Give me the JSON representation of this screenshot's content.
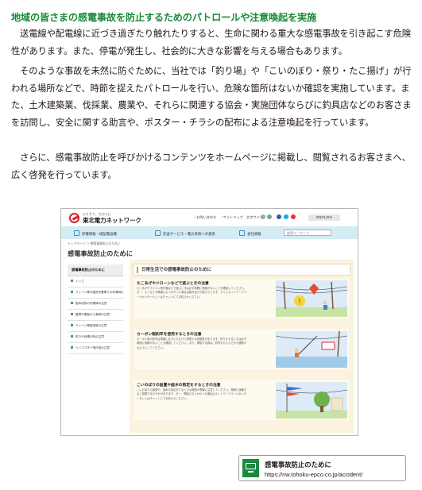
{
  "heading": "地域の皆さまの感電事故を防止するためのパトロールや注意喚起を実施",
  "paragraphs": [
    "送電線や配電線に近づき過ぎたり触れたりすると、生命に関わる重大な感電事故を引き起こす危険性があります。また、停電が発生し、社会的に大きな影響を与える場合もあります。",
    "そのような事故を未然に防ぐために、当社では「釣り場」や「こいのぼり・祭り・たこ揚げ」が行われる場所などで、時節を捉えたパトロールを行い、危険な箇所はないか確認を実施しています。また、土木建築業、伐採業、農業や、それらに関連する協会・実施団体ならびに釣具店などのお客さまを訪問し、安全に関する助言や、ポスター・チラシの配布による注意喚起を行っています。",
    "さらに、感電事故防止を呼びかけるコンテンツをホームページに掲載し、閲覧されるお客さまへ、広く啓発を行っています。"
  ],
  "screenshot": {
    "brand_sub": "よりそう、ちからに",
    "brand": "東北電力ネットワーク",
    "util_links": "・お問い合わせ　・サイトマップ　文字サイズ",
    "english": "ENGLISH",
    "nav": [
      "停電情報・総配電設備",
      "託送サービス・電力系統への連系",
      "会社情報"
    ],
    "search_placeholder": "検索キーワード",
    "breadcrumb": "トップページ ＞ 感電事故防止のために",
    "title": "感電事故防止のために",
    "side_head": "感電事故防止のために",
    "side_items": [
      "トップ",
      "クレーン車や高所作業車での作業時の注意",
      "樹木伐採の作業時の注意",
      "屋根や看板の工事時の注意",
      "クレーン車使用時の注意",
      "釣りや凧揚げ時の注意",
      "ヘリコプター飛行時の注意"
    ],
    "main_head": "日常生活での感電事故防止のために",
    "sections": [
      {
        "title": "たこあげやドローンなどで遊ぶときの注意",
        "text": "たこあげやラジコン飛行機などで遊ぶときは必ず周囲に電線がないことを確認してください。万一、たこなどが電線に引っかかった場合は絶対自分で取ろうとせず、すぐにネットワークコールセンターもしくはチャットにてお知らせください。"
      },
      {
        "title": "カーボン製釣竿を使用するときの注意",
        "text": "カーボン製の釣竿は電線に近づいただけで感電する危険性があります。釣りをするときは必ず周囲に電線がないことを確認してください。また、移動する際は、釣竿をたたんでから移動するようにしてください。"
      },
      {
        "title": "こいのぼりの設置や庭木の剪定をするときの注意",
        "text": "こいのぼりの設置や、庭木の剪定をするときは周囲の電線に注意してください。電線に接触すると感電するおそれがあります。万一、電線に引っかかった場合はネットワークコールセンターもしくはチャットにてお知らせください。"
      }
    ]
  },
  "link_card": {
    "title": "感電事故防止のために",
    "url": "https://nw.tohoku-epco.co.jp/accident/"
  },
  "colors": {
    "heading": "#1a8a3c",
    "brand_red": "#d4202c",
    "nav_bg": "#d5ecf4",
    "card_icon": "#1a8a3c"
  }
}
